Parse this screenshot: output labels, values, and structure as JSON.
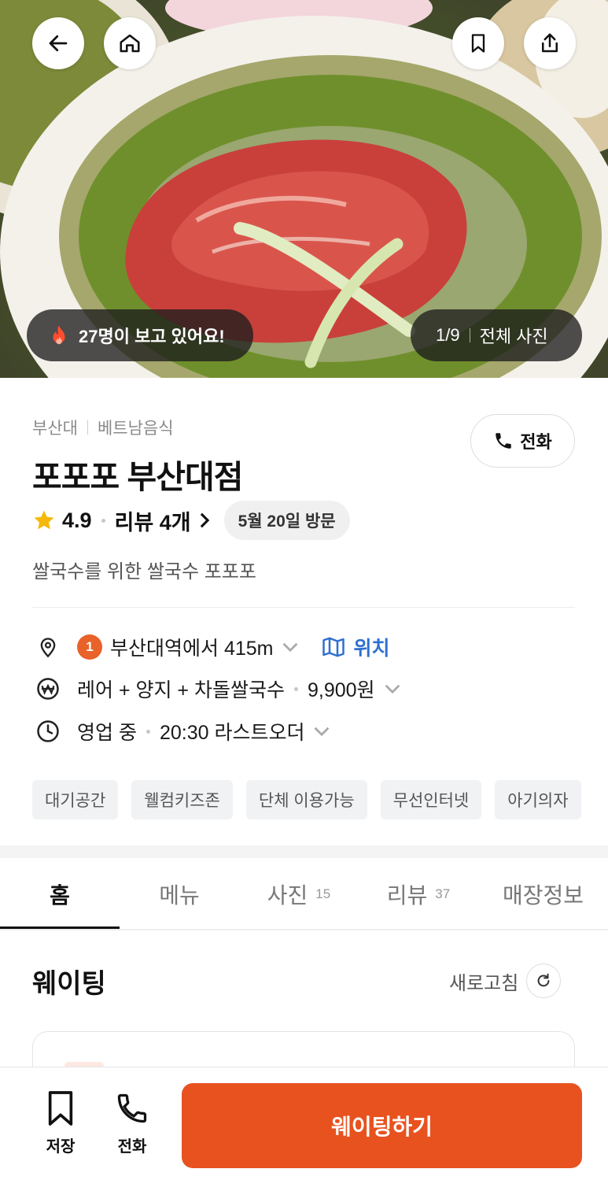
{
  "hero": {
    "viewers_text": "27명이 보고 있어요!",
    "photo_counter": "1/9",
    "all_photos_label": "전체 사진"
  },
  "store": {
    "area": "부산대",
    "category": "베트남음식",
    "name": "포포포 부산대점",
    "call_label": "전화",
    "rating": "4.9",
    "reviews_label": "리뷰 4개",
    "visit_chip": "5월 20일 방문",
    "description": "쌀국수를 위한 쌀국수 포포포"
  },
  "info": {
    "station_badge": "1",
    "distance": "부산대역에서 415m",
    "map_label": "위치",
    "menu": "레어 + 양지 + 차돌쌀국수",
    "price": "9,900원",
    "status": "영업 중",
    "last_order": "20:30 라스트오더"
  },
  "tags": [
    "대기공간",
    "웰컴키즈존",
    "단체 이용가능",
    "무선인터넷",
    "아기의자"
  ],
  "tabs": [
    {
      "label": "홈",
      "count": ""
    },
    {
      "label": "메뉴",
      "count": ""
    },
    {
      "label": "사진",
      "count": "15"
    },
    {
      "label": "리뷰",
      "count": "37"
    },
    {
      "label": "매장정보",
      "count": ""
    }
  ],
  "waiting": {
    "title": "웨이팅",
    "refresh_label": "새로고침"
  },
  "bottom_bar": {
    "save_label": "저장",
    "call_label": "전화",
    "cta_label": "웨이팅하기"
  },
  "colors": {
    "accent": "#e8521f",
    "link": "#2f6fd1",
    "star": "#f5b90b"
  }
}
